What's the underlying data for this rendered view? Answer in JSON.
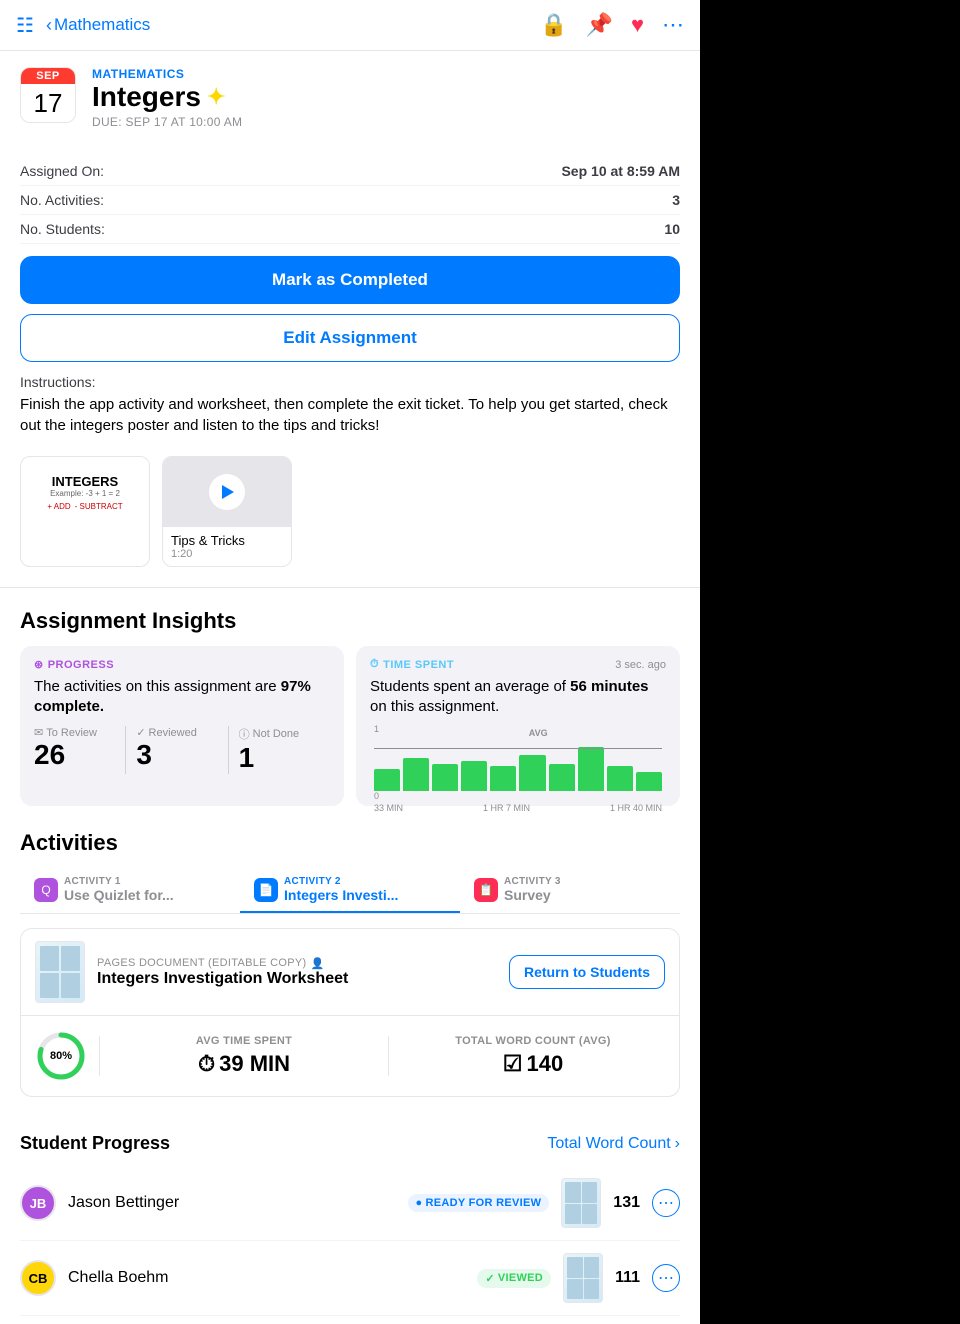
{
  "nav": {
    "back_label": "Mathematics",
    "sidebar_icon": "⊞",
    "icons": [
      "lock",
      "pin",
      "heart",
      "more"
    ]
  },
  "assignment": {
    "month": "SEP",
    "day": "17",
    "subject": "MATHEMATICS",
    "title": "Integers",
    "sparkle": "✦",
    "due": "DUE: SEP 17 AT 10:00 AM",
    "assigned_on_label": "Assigned On:",
    "assigned_on_val": "Sep 10 at 8:59 AM",
    "activities_label": "No. Activities:",
    "activities_val": "3",
    "students_label": "No. Students:",
    "students_val": "10"
  },
  "buttons": {
    "mark_complete": "Mark as Completed",
    "edit_assignment": "Edit Assignment",
    "return_students": "Return to Students"
  },
  "instructions": {
    "label": "Instructions:",
    "text": "Finish the app activity and worksheet, then complete the exit ticket. To help you get started, check out the integers poster and listen to the tips and tricks!"
  },
  "attachments": [
    {
      "name": "INTEGERS",
      "type": "poster",
      "is_video": false
    },
    {
      "name": "Tips & Tricks",
      "sub": "1:20",
      "is_video": true
    }
  ],
  "insights": {
    "title": "Assignment Insights",
    "progress": {
      "label": "PROGRESS",
      "text": "The activities on this assignment are 97% complete.",
      "percent": "97"
    },
    "time_spent": {
      "label": "TIME SPENT",
      "time_ago": "3 sec. ago",
      "text": "Students spent an average of 56 minutes on this assignment."
    },
    "stats": {
      "to_review_label": "To Review",
      "to_review_val": "26",
      "reviewed_label": "Reviewed",
      "reviewed_val": "3",
      "not_done_label": "Not Done",
      "not_done_val": "1"
    },
    "chart": {
      "y_labels": [
        "1",
        "0"
      ],
      "x_labels": [
        "33 MIN",
        "1 HR 7 MIN",
        "1 HR 40 MIN"
      ],
      "avg_label": "AVG",
      "bars": [
        30,
        45,
        50,
        60,
        42,
        55,
        50,
        70,
        45,
        38
      ]
    }
  },
  "activities": {
    "title": "Activities",
    "tabs": [
      {
        "num": "ACTIVITY 1",
        "name": "Use Quizlet for...",
        "active": false
      },
      {
        "num": "ACTIVITY 2",
        "name": "Integers Investi...",
        "active": true
      },
      {
        "num": "ACTIVITY 3",
        "name": "Survey",
        "active": false
      }
    ],
    "doc": {
      "type": "PAGES DOCUMENT (EDITABLE COPY)",
      "name": "Integers Investigation Worksheet"
    },
    "avg_time_label": "AVG TIME SPENT",
    "avg_time_val": "39 MIN",
    "word_count_label": "TOTAL WORD COUNT (AVG)",
    "word_count_val": "140",
    "progress_pct": "80%",
    "progress_num": 80
  },
  "student_progress": {
    "title": "Student Progress",
    "word_count_link": "Total Word Count",
    "students": [
      {
        "initials": "JB",
        "name": "Jason Bettinger",
        "status": "READY FOR REVIEW",
        "status_type": "review",
        "word_count": "131",
        "avatar_color": "#AF52DE",
        "avatar_text_color": "#fff"
      },
      {
        "initials": "CB",
        "name": "Chella Boehm",
        "status": "VIEWED",
        "status_type": "viewed",
        "word_count": "111",
        "avatar_color": "#FFD60A",
        "avatar_text_color": "#000"
      }
    ]
  }
}
